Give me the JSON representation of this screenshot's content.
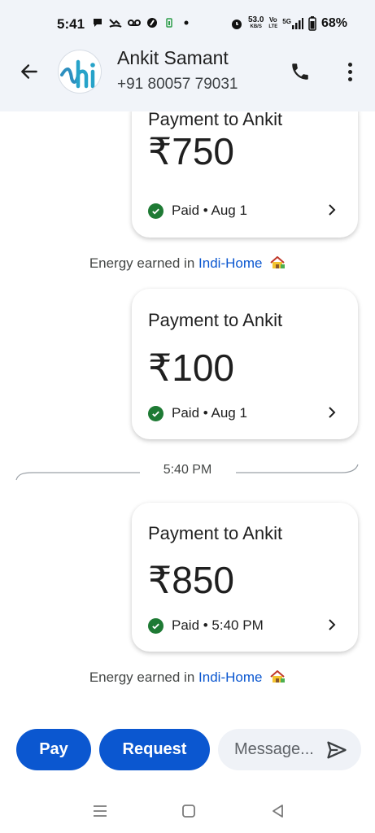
{
  "status_bar": {
    "time": "5:41",
    "net_speed_value": "53.0",
    "net_speed_unit": "KB/S",
    "volte_top": "Vo",
    "volte_bottom": "LTE",
    "network": "5G",
    "battery": "68%"
  },
  "header": {
    "contact_name": "Ankit Samant",
    "contact_phone": "+91 80057 79031",
    "avatar_text": "hi"
  },
  "messages": [
    {
      "title": "Payment to Ankit",
      "amount": "₹750",
      "status": "Paid • Aug 1"
    },
    {
      "title": "Payment to Ankit",
      "amount": "₹100",
      "status": "Paid • Aug 1"
    },
    {
      "title": "Payment to Ankit",
      "amount": "₹850",
      "status": "Paid • 5:40 PM"
    }
  ],
  "energy_note": {
    "prefix": "Energy earned in",
    "link": "Indi-Home"
  },
  "divider_time": "5:40 PM",
  "composer": {
    "pay_label": "Pay",
    "request_label": "Request",
    "message_placeholder": "Message..."
  },
  "colors": {
    "accent": "#0b57d0",
    "paid_green": "#1e7a34",
    "header_bg": "#f1f4f9"
  }
}
